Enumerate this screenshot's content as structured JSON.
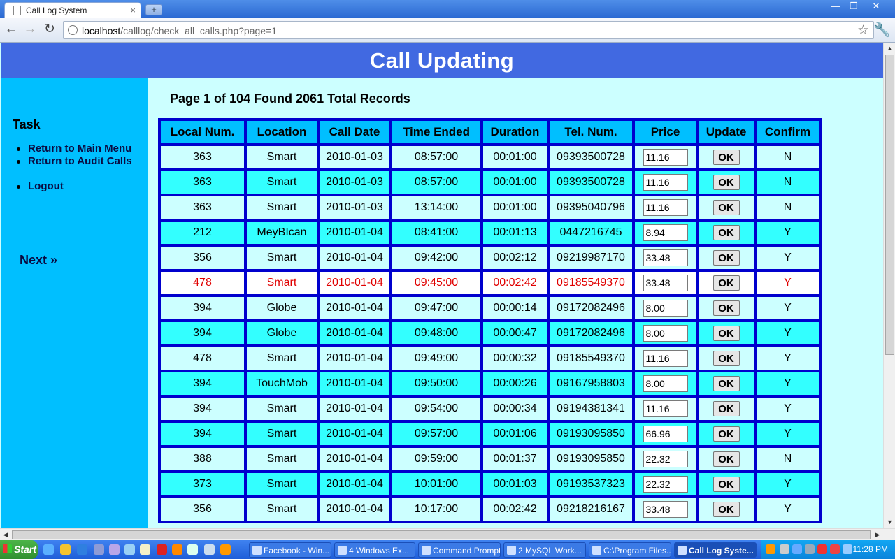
{
  "browser": {
    "tab_title": "Call Log System",
    "tab_close": "×",
    "new_tab": "+",
    "url_host": "localhost",
    "url_path": "/calllog/check_all_calls.php?page=1",
    "back": "←",
    "forward": "→",
    "reload": "↻",
    "star": "☆",
    "wrench": "🔧",
    "minimize": "—",
    "restore": "❐",
    "close": "✕"
  },
  "page": {
    "header": "Call Updating",
    "task_title": "Task",
    "menu": [
      "Return to Main Menu",
      "Return to Audit Calls",
      "Logout"
    ],
    "next": "Next »",
    "page_info": "Page 1 of 104 Found 2061 Total Records"
  },
  "table": {
    "columns": [
      "Local Num.",
      "Location",
      "Call Date",
      "Time Ended",
      "Duration",
      "Tel. Num.",
      "Price",
      "Update",
      "Confirm"
    ],
    "button_label": "OK",
    "rows": [
      {
        "local": "363",
        "location": "Smart",
        "date": "2010-01-03",
        "time": "08:57:00",
        "duration": "00:01:00",
        "tel": "09393500728",
        "price": "11.16",
        "confirm": "N"
      },
      {
        "local": "363",
        "location": "Smart",
        "date": "2010-01-03",
        "time": "08:57:00",
        "duration": "00:01:00",
        "tel": "09393500728",
        "price": "11.16",
        "confirm": "N"
      },
      {
        "local": "363",
        "location": "Smart",
        "date": "2010-01-03",
        "time": "13:14:00",
        "duration": "00:01:00",
        "tel": "09395040796",
        "price": "11.16",
        "confirm": "N"
      },
      {
        "local": "212",
        "location": "MeyBIcan",
        "date": "2010-01-04",
        "time": "08:41:00",
        "duration": "00:01:13",
        "tel": "0447216745",
        "price": "8.94",
        "confirm": "Y"
      },
      {
        "local": "356",
        "location": "Smart",
        "date": "2010-01-04",
        "time": "09:42:00",
        "duration": "00:02:12",
        "tel": "09219987170",
        "price": "33.48",
        "confirm": "Y"
      },
      {
        "local": "478",
        "location": "Smart",
        "date": "2010-01-04",
        "time": "09:45:00",
        "duration": "00:02:42",
        "tel": "09185549370",
        "price": "33.48",
        "confirm": "Y"
      },
      {
        "local": "394",
        "location": "Globe",
        "date": "2010-01-04",
        "time": "09:47:00",
        "duration": "00:00:14",
        "tel": "09172082496",
        "price": "8.00",
        "confirm": "Y"
      },
      {
        "local": "394",
        "location": "Globe",
        "date": "2010-01-04",
        "time": "09:48:00",
        "duration": "00:00:47",
        "tel": "09172082496",
        "price": "8.00",
        "confirm": "Y"
      },
      {
        "local": "478",
        "location": "Smart",
        "date": "2010-01-04",
        "time": "09:49:00",
        "duration": "00:00:32",
        "tel": "09185549370",
        "price": "11.16",
        "confirm": "Y"
      },
      {
        "local": "394",
        "location": "TouchMob",
        "date": "2010-01-04",
        "time": "09:50:00",
        "duration": "00:00:26",
        "tel": "09167958803",
        "price": "8.00",
        "confirm": "Y"
      },
      {
        "local": "394",
        "location": "Smart",
        "date": "2010-01-04",
        "time": "09:54:00",
        "duration": "00:00:34",
        "tel": "09194381341",
        "price": "11.16",
        "confirm": "Y"
      },
      {
        "local": "394",
        "location": "Smart",
        "date": "2010-01-04",
        "time": "09:57:00",
        "duration": "00:01:06",
        "tel": "09193095850",
        "price": "66.96",
        "confirm": "Y"
      },
      {
        "local": "388",
        "location": "Smart",
        "date": "2010-01-04",
        "time": "09:59:00",
        "duration": "00:01:37",
        "tel": "09193095850",
        "price": "22.32",
        "confirm": "N"
      },
      {
        "local": "373",
        "location": "Smart",
        "date": "2010-01-04",
        "time": "10:01:00",
        "duration": "00:01:03",
        "tel": "09193537323",
        "price": "22.32",
        "confirm": "Y"
      },
      {
        "local": "356",
        "location": "Smart",
        "date": "2010-01-04",
        "time": "10:17:00",
        "duration": "00:02:42",
        "tel": "09218216167",
        "price": "33.48",
        "confirm": "Y"
      }
    ]
  },
  "taskbar": {
    "start": "Start",
    "tasks": [
      "Facebook - Win...",
      "4 Windows Ex...",
      "Command Prompt",
      "2 MySQL Work...",
      "C:\\Program Files...",
      "Call Log Syste..."
    ],
    "clock": "11:28 PM"
  },
  "colors": {
    "header_bg": "#4169e1",
    "sidebar_bg": "#00bfff",
    "page_bg": "#ccffff",
    "row_alt_bg": "#33ffff",
    "table_border": "#0000cd",
    "highlight_text": "#e00000"
  }
}
